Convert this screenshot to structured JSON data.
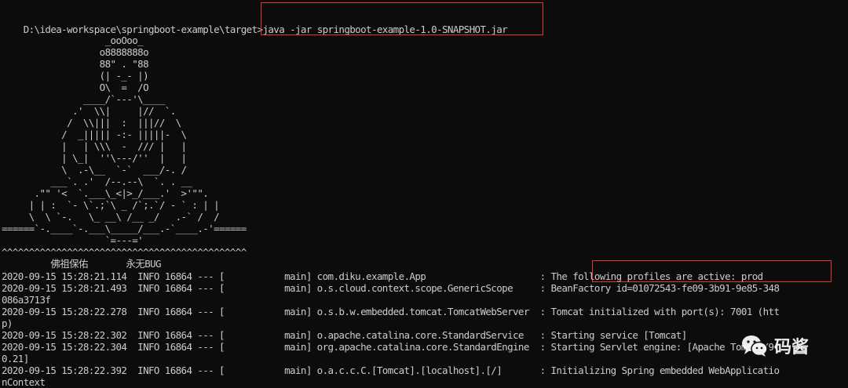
{
  "terminal": {
    "prompt": "D:\\idea-workspace\\springboot-example\\target>",
    "command": "java -jar springboot-example-1.0-SNAPSHOT.jar",
    "banner": [
      "                   _ooOoo_",
      "                  o8888888o",
      "                  88\" . \"88",
      "                  (| -_- |)",
      "                  O\\  =  /O",
      "               ____/`---'\\____",
      "             .'  \\\\|     |//  `.",
      "            /  \\\\|||  :  |||//  \\",
      "           /  _||||| -:- |||||-  \\",
      "           |   | \\\\\\  -  /// |   |",
      "           | \\_|  ''\\---/''  |   |",
      "           \\  .-\\__  `-`  ___/-. /",
      "         ___`. .'  /--.--\\  `. . __",
      "      .\"\" '<  `.___\\_<|>_/___.'  >'\"\".",
      "     | | :  `- \\`.;`\\ _ /`;.`/ - ` : | |",
      "     \\  \\ `-.   \\_ __\\ /__ _/   .-` /  /",
      "======`-.____`-.___\\_____/___.-`____.-'======",
      "                   `=---='",
      "^^^^^^^^^^^^^^^^^^^^^^^^^^^^^^^^^^^^^^^^^^^^^",
      "         佛祖保佑       永无BUG"
    ],
    "logs": [
      "2020-09-15 15:28:21.114  INFO 16864 --- [           main] com.diku.example.App                     : The following profiles are active: prod",
      "2020-09-15 15:28:21.493  INFO 16864 --- [           main] o.s.cloud.context.scope.GenericScope     : BeanFactory id=01072543-fe09-3b91-9e85-348",
      "086a3713f",
      "2020-09-15 15:28:22.278  INFO 16864 --- [           main] o.s.b.w.embedded.tomcat.TomcatWebServer  : Tomcat initialized with port(s): 7001 (htt",
      "p)",
      "2020-09-15 15:28:22.302  INFO 16864 --- [           main] o.apache.catalina.core.StandardService   : Starting service [Tomcat]",
      "2020-09-15 15:28:22.304  INFO 16864 --- [           main] org.apache.catalina.core.StandardEngine  : Starting Servlet engine: [Apache Tomcat/9.",
      "0.21]",
      "2020-09-15 15:28:22.392  INFO 16864 --- [           main] o.a.c.c.C.[Tomcat].[localhost].[/]       : Initializing Spring embedded WebApplicatio",
      "nContext"
    ]
  },
  "watermark": {
    "text": "码酱",
    "icon": "wechat-icon"
  },
  "colors": {
    "background": "#0c0c0c",
    "text": "#cccccc",
    "highlight": "#e8322f"
  }
}
